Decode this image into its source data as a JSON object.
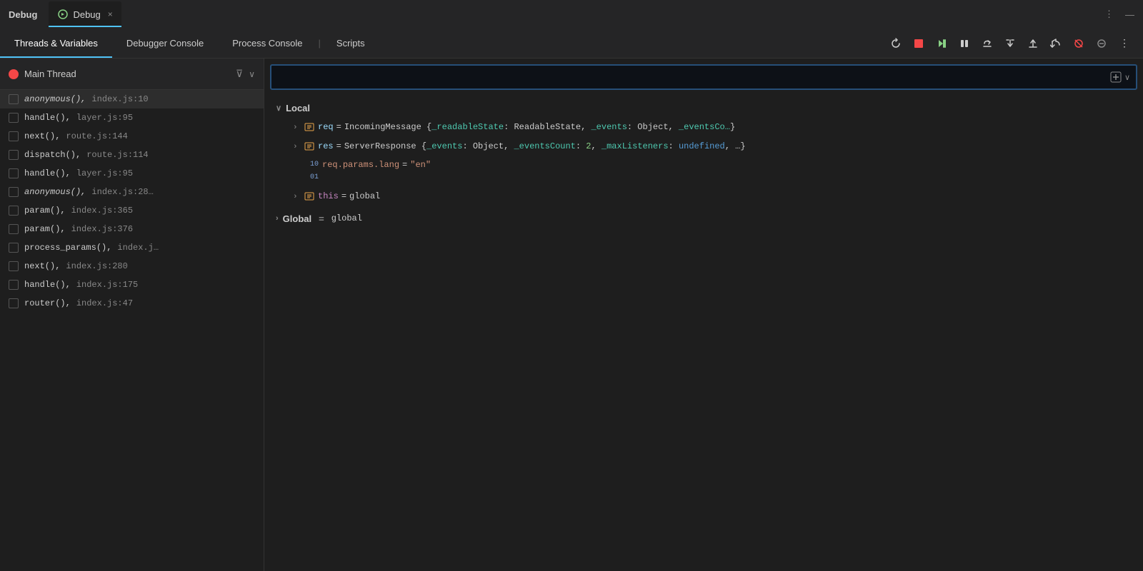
{
  "titleBar": {
    "appLabel": "Debug",
    "tabLabel": "Debug",
    "closeLabel": "×",
    "actionsMore": "⋮",
    "actionsMin": "—"
  },
  "tabs": {
    "threadsVariables": "Threads & Variables",
    "debuggerConsole": "Debugger Console",
    "processConsole": "Process Console",
    "scripts": "Scripts"
  },
  "toolbar": {
    "restart": "↺",
    "stop": "■",
    "continue": "▶▶",
    "pause": "⏸",
    "stepOver": "↗",
    "stepInto": "→",
    "stepOut": "↙",
    "stepBack": "↑",
    "breakpoints": "⊘",
    "more": "⋮"
  },
  "thread": {
    "name": "Main Thread",
    "filter": "⊽",
    "chevron": "∨"
  },
  "stackFrames": [
    {
      "func": "anonymous()",
      "file": "index.js:10",
      "italic": true,
      "active": true
    },
    {
      "func": "handle()",
      "file": "layer.js:95",
      "italic": false,
      "active": false
    },
    {
      "func": "next()",
      "file": "route.js:144",
      "italic": false,
      "active": false
    },
    {
      "func": "dispatch()",
      "file": "route.js:114",
      "italic": false,
      "active": false
    },
    {
      "func": "handle()",
      "file": "layer.js:95",
      "italic": false,
      "active": false
    },
    {
      "func": "anonymous()",
      "file": "index.js:28…",
      "italic": true,
      "active": false
    },
    {
      "func": "param()",
      "file": "index.js:365",
      "italic": false,
      "active": false
    },
    {
      "func": "param()",
      "file": "index.js:376",
      "italic": false,
      "active": false
    },
    {
      "func": "process_params()",
      "file": "index.j…",
      "italic": false,
      "active": false
    },
    {
      "func": "next()",
      "file": "index.js:280",
      "italic": false,
      "active": false
    },
    {
      "func": "handle()",
      "file": "index.js:175",
      "italic": false,
      "active": false
    },
    {
      "func": "router()",
      "file": "index.js:47",
      "italic": false,
      "active": false
    }
  ],
  "expression": {
    "placeholder": "",
    "addIcon": "+",
    "chevronIcon": "∨"
  },
  "variables": {
    "localSection": "Local",
    "globalSection": "Global = global",
    "locals": [
      {
        "type": "object",
        "name": "req",
        "eq": "=",
        "value": "IncomingMessage {_readableState: ReadableState, _events: Object, _eventsCo…",
        "expandable": true
      },
      {
        "type": "object",
        "name": "res",
        "eq": "=",
        "value": "ServerResponse {_events: Object, _eventsCount: 2, _maxListeners: undefined, …",
        "expandable": true
      },
      {
        "type": "binary",
        "name": "req.params.lang",
        "eq": "=",
        "value": "\"en\"",
        "expandable": false
      },
      {
        "type": "object",
        "name": "this",
        "eq": "=",
        "value": "global",
        "expandable": true,
        "nameClass": "this-name"
      }
    ]
  }
}
